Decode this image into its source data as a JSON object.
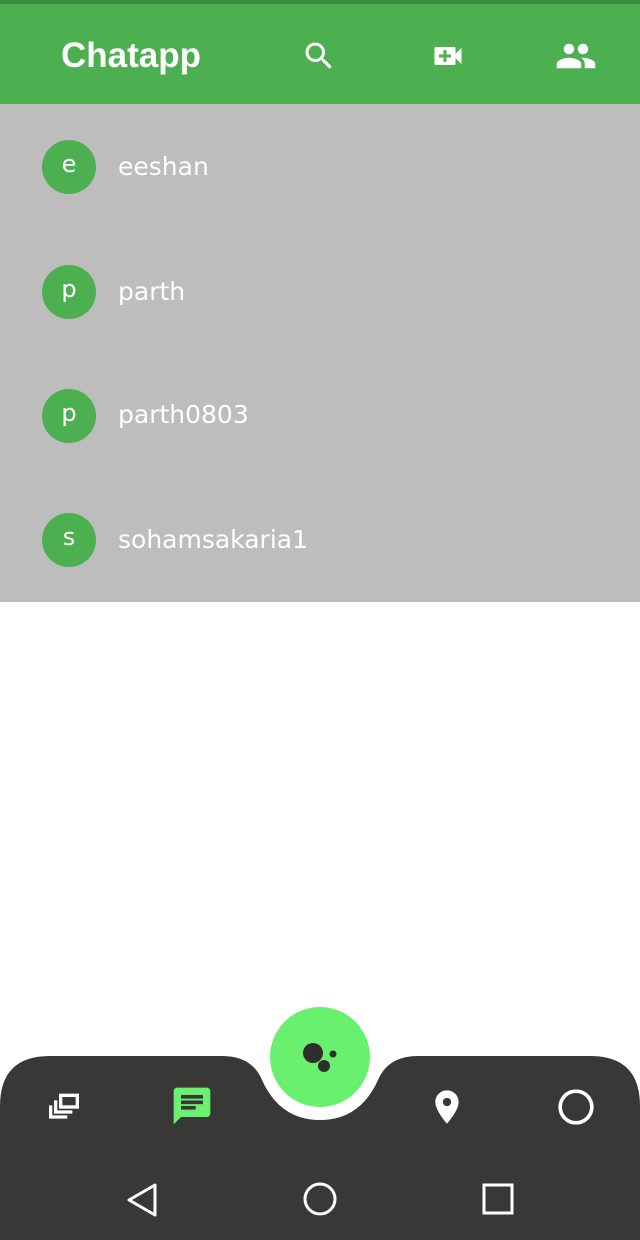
{
  "app_bar": {
    "title": "Chatapp",
    "icons": [
      "search-icon",
      "video-call-icon",
      "group-icon"
    ]
  },
  "contacts": [
    {
      "initial": "e",
      "name": "eeshan"
    },
    {
      "initial": "p",
      "name": "parth"
    },
    {
      "initial": "p",
      "name": "parth0803"
    },
    {
      "initial": "s",
      "name": "sohamsakaria1"
    }
  ],
  "bottom_nav": {
    "items": [
      "stories-icon",
      "chat-icon",
      "location-pin-icon",
      "status-circle-icon"
    ],
    "active": "chat-icon",
    "fab_icon": "assistant-dots-icon"
  },
  "system_nav": [
    "back-icon",
    "home-icon",
    "recents-icon"
  ],
  "colors": {
    "primary": "#4caf50",
    "primary_dark": "#388e3c",
    "list_background": "#bdbdbd",
    "nav_background": "#383937",
    "fab": "#69f06e",
    "active_icon": "#69f06e"
  }
}
